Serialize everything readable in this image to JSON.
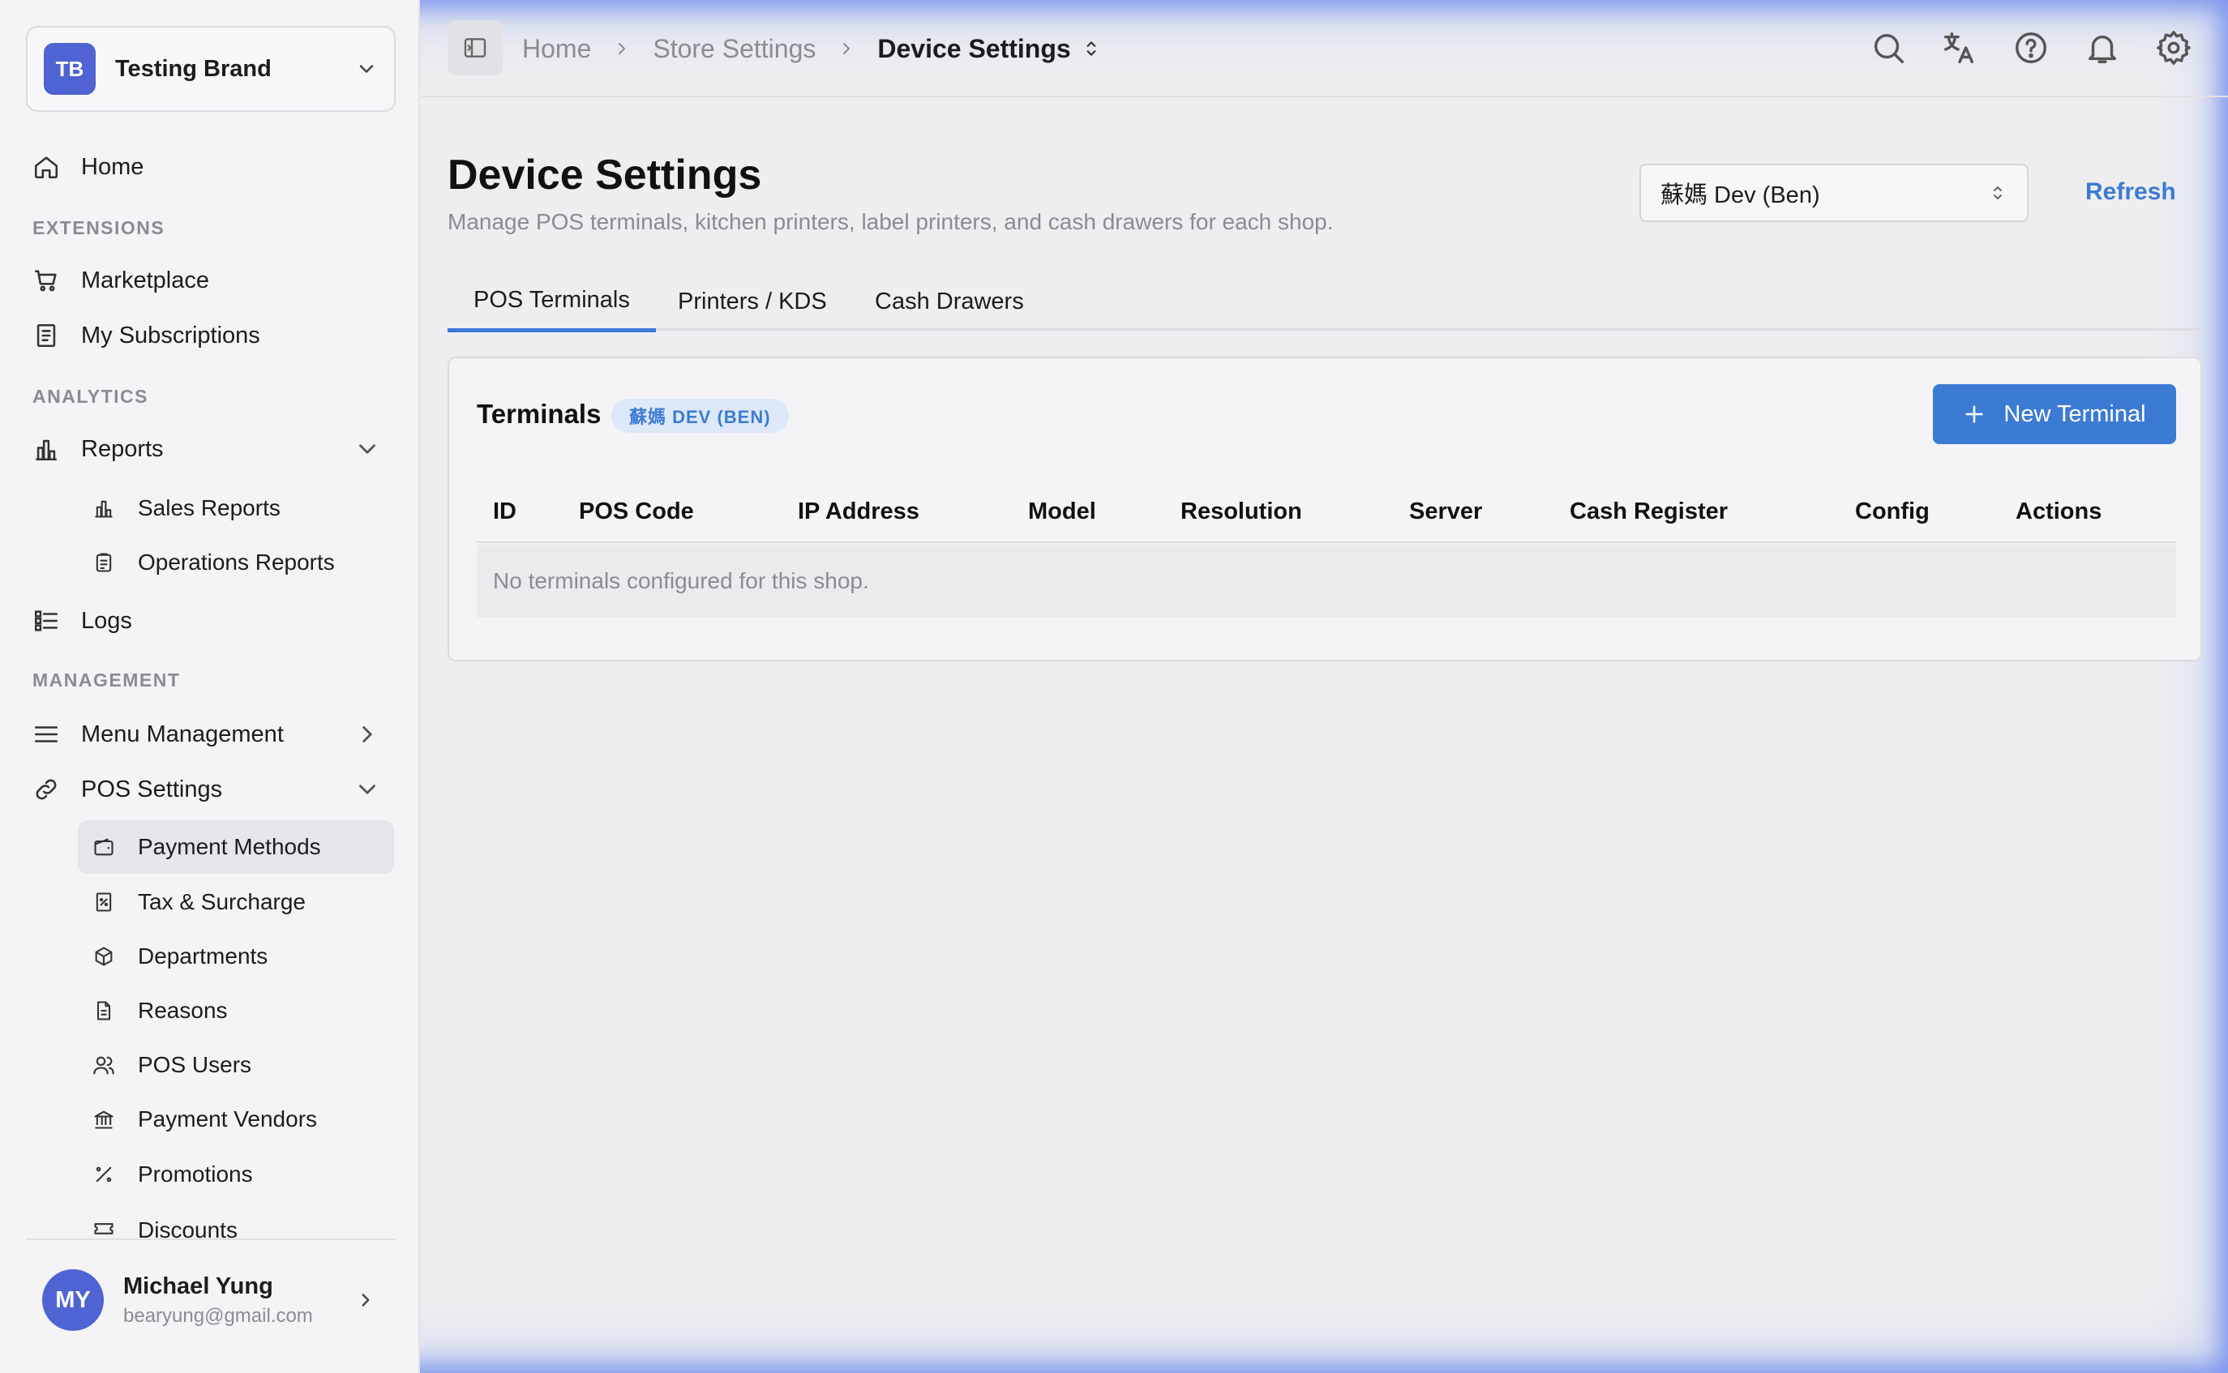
{
  "brand": {
    "initials": "TB",
    "name": "Testing Brand"
  },
  "sidebar": {
    "home": "Home",
    "sections": {
      "extensions": "EXTENSIONS",
      "analytics": "ANALYTICS",
      "management": "MANAGEMENT"
    },
    "extensions": [
      "Marketplace",
      "My Subscriptions"
    ],
    "reports": {
      "label": "Reports",
      "children": [
        "Sales Reports",
        "Operations Reports"
      ]
    },
    "logs": "Logs",
    "menu_management": "Menu Management",
    "pos_settings": {
      "label": "POS Settings",
      "children": [
        "Payment Methods",
        "Tax & Surcharge",
        "Departments",
        "Reasons",
        "POS Users",
        "Payment Vendors",
        "Promotions",
        "Discounts"
      ],
      "active": "Payment Methods"
    }
  },
  "user": {
    "initials": "MY",
    "name": "Michael Yung",
    "email": "bearyung@gmail.com"
  },
  "breadcrumb": {
    "items": [
      "Home",
      "Store Settings"
    ],
    "current": "Device Settings"
  },
  "page": {
    "title": "Device Settings",
    "subtitle": "Manage POS terminals, kitchen printers, label printers, and cash drawers for each shop.",
    "shop_select": "蘇媽 Dev (Ben)",
    "refresh": "Refresh"
  },
  "tabs": [
    {
      "label": "POS Terminals",
      "active": true
    },
    {
      "label": "Printers / KDS",
      "active": false
    },
    {
      "label": "Cash Drawers",
      "active": false
    }
  ],
  "terminals": {
    "title": "Terminals",
    "badge": "蘇媽 DEV (BEN)",
    "new_button": "New Terminal",
    "columns": [
      "ID",
      "POS Code",
      "IP Address",
      "Model",
      "Resolution",
      "Server",
      "Cash Register",
      "Config",
      "Actions"
    ],
    "empty_message": "No terminals configured for this shop."
  },
  "colors": {
    "accent": "#3b7bd4",
    "avatar": "#4f63d2",
    "background": "#eeeef0"
  }
}
